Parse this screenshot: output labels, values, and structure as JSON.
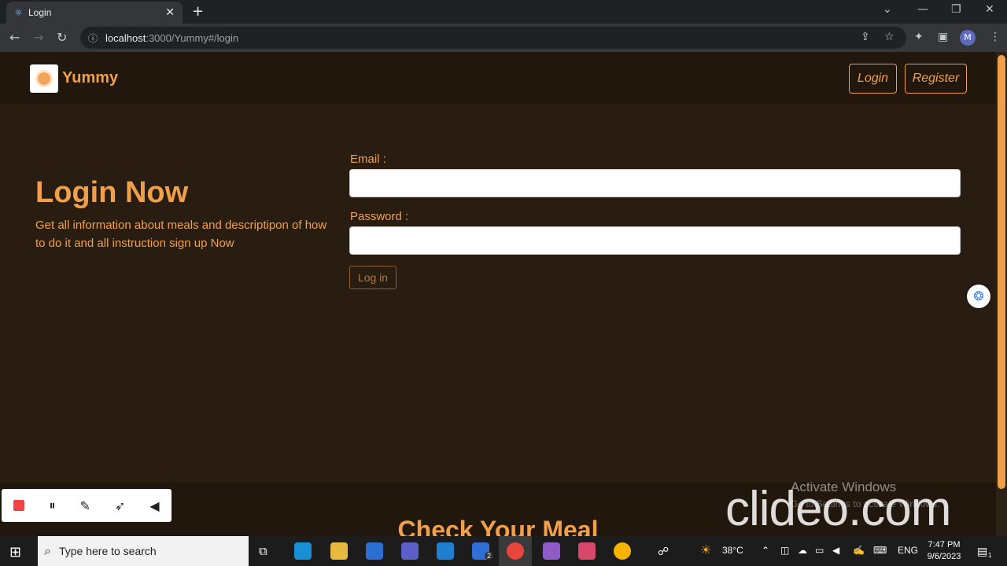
{
  "browser": {
    "tab_title": "Login",
    "url_host": "localhost",
    "url_path": ":3000/Yummy#/login",
    "profile_initial": "M"
  },
  "navbar": {
    "brand": "Yummy",
    "login_label": "Login",
    "register_label": "Register"
  },
  "hero": {
    "title": "Login Now",
    "description": "Get all information about meals and descriptipon of how to do it and all instruction sign up Now"
  },
  "form": {
    "email_label": "Email :",
    "email_value": "",
    "password_label": "Password :",
    "password_value": "",
    "submit_label": "Log in"
  },
  "section2": {
    "title": "Check Your Meal"
  },
  "overlay": {
    "activate_title": "Activate Windows",
    "activate_sub": "Go to Settings to activate Windows.",
    "watermark": "clideo.com"
  },
  "taskbar": {
    "search_placeholder": "Type here to search",
    "weather": "38°C",
    "lang": "ENG",
    "time": "7:47 PM",
    "date": "9/6/2023",
    "notification_count": "1",
    "todo_badge": "2"
  },
  "colors": {
    "accent": "#f0a04b",
    "page_bg": "#291d12",
    "navbar_bg": "#21170d"
  }
}
